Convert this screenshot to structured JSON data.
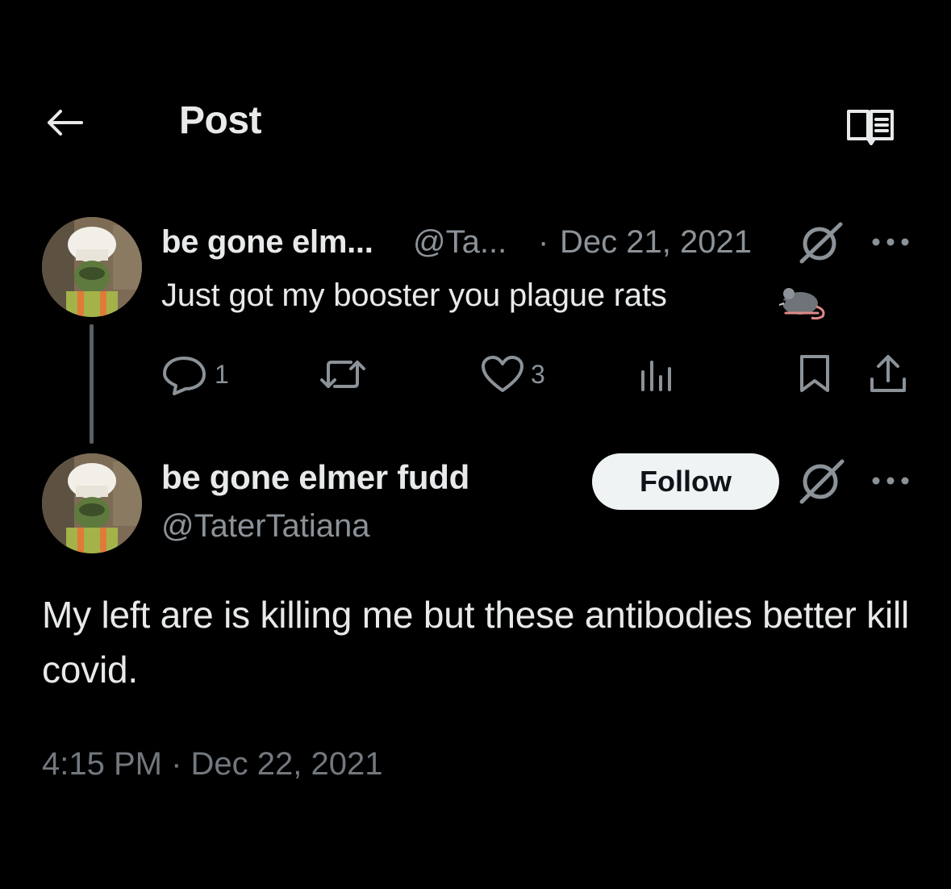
{
  "header": {
    "title": "Post",
    "back_icon": "arrow-left-icon",
    "reader_icon": "book-open-icon"
  },
  "parent_tweet": {
    "display_name": "be gone elm...",
    "handle": "@Ta...",
    "separator": "·",
    "date": "Dec 21, 2021",
    "text": "Just got my booster you plague rats",
    "emoji_icon": "rat-icon",
    "actions": {
      "reply_count": "1",
      "retweet_count": "",
      "like_count": "3",
      "views_count": ""
    }
  },
  "main_tweet": {
    "display_name": "be gone elmer fudd",
    "handle": "@TaterTatiana",
    "follow_label": "Follow",
    "text": "My left are is killing me but these antibodies better kill covid.",
    "timestamp": "4:15 PM · Dec 22, 2021"
  },
  "colors": {
    "background": "#000000",
    "primary_text": "#e7e9ea",
    "secondary_text": "#8b9298",
    "follow_bg": "#eff3f4"
  }
}
